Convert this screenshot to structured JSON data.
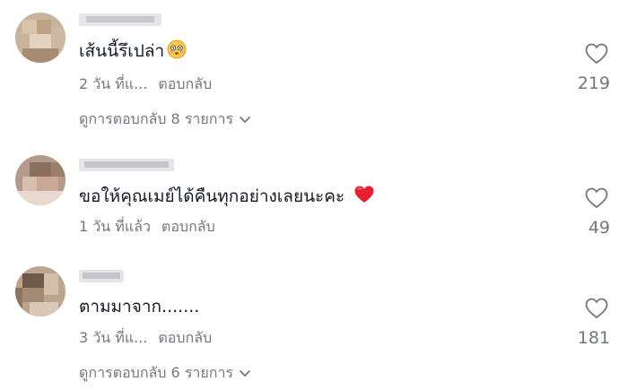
{
  "comments": [
    {
      "text": "เส้นนี้รึเปล่า",
      "emoji": "flushed-face",
      "time": "2 วัน ที่แ...",
      "reply_label": "ตอบกลับ",
      "likes": "219",
      "view_replies": "ดูการตอบกลับ 8 รายการ"
    },
    {
      "text": "ขอให้คุณเมย์ได้คืนทุกอย่างเลยนะคะ",
      "emoji": "red-heart",
      "time": "1 วัน ที่แล้ว",
      "reply_label": "ตอบกลับ",
      "likes": "49"
    },
    {
      "text": "ตามมาจาก.......",
      "time": "3 วัน ที่แ...",
      "reply_label": "ตอบกลับ",
      "likes": "181",
      "view_replies": "ดูการตอบกลับ 6 รายการ"
    }
  ],
  "colors": {
    "text": "#161823",
    "secondary": "#75777f",
    "heart_emoji": "#e8202f",
    "flushed_face": "#f7c948"
  },
  "icons": {
    "like": "heart-outline-icon",
    "expand": "chevron-down-icon"
  }
}
